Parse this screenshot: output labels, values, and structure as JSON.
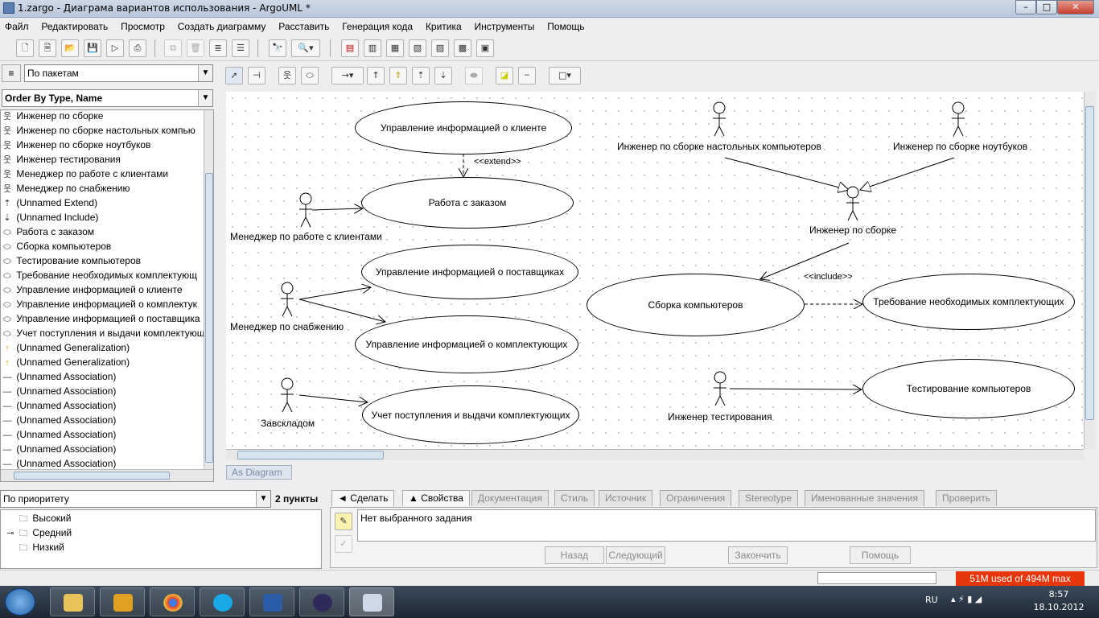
{
  "window": {
    "title": "1.zargo - Диаграма вариантов использования - ArgoUML *",
    "controls": [
      "–",
      "□",
      "✕"
    ]
  },
  "menu": [
    "Файл",
    "Редактировать",
    "Просмотр",
    "Создать диаграмму",
    "Расставить",
    "Генерация кода",
    "Критика",
    "Инструменты",
    "Помощь"
  ],
  "explorer": {
    "perspective": "По пакетам",
    "order": "Order By Type, Name",
    "items": [
      {
        "icon": "actor",
        "label": "Инженер по сборке"
      },
      {
        "icon": "actor",
        "label": "Инженер по сборке настольных компью"
      },
      {
        "icon": "actor",
        "label": "Инженер по сборке ноутбуков"
      },
      {
        "icon": "actor",
        "label": "Инженер тестирования"
      },
      {
        "icon": "actor",
        "label": "Менеджер по работе с клиентами"
      },
      {
        "icon": "actor",
        "label": "Менеджер по снабжению"
      },
      {
        "icon": "extend",
        "label": "(Unnamed Extend)"
      },
      {
        "icon": "include",
        "label": "(Unnamed Include)"
      },
      {
        "icon": "usecase",
        "label": "Работа с заказом"
      },
      {
        "icon": "usecase",
        "label": "Сборка компьютеров"
      },
      {
        "icon": "usecase",
        "label": "Тестирование компьютеров"
      },
      {
        "icon": "usecase",
        "label": "Требование необходимых комплектующ"
      },
      {
        "icon": "usecase",
        "label": "Управление информацией о клиенте"
      },
      {
        "icon": "usecase",
        "label": "Управление информацией о комплектук"
      },
      {
        "icon": "usecase",
        "label": "Управление информацией о поставщика"
      },
      {
        "icon": "usecase",
        "label": "Учет поступления и выдачи комплектующ"
      },
      {
        "icon": "generalization",
        "label": "(Unnamed Generalization)"
      },
      {
        "icon": "generalization",
        "label": "(Unnamed Generalization)"
      },
      {
        "icon": "association",
        "label": "(Unnamed Association)"
      },
      {
        "icon": "association",
        "label": "(Unnamed Association)"
      },
      {
        "icon": "association",
        "label": "(Unnamed Association)"
      },
      {
        "icon": "association",
        "label": "(Unnamed Association)"
      },
      {
        "icon": "association",
        "label": "(Unnamed Association)"
      },
      {
        "icon": "association",
        "label": "(Unnamed Association)"
      },
      {
        "icon": "association",
        "label": "(Unnamed Association)"
      }
    ]
  },
  "todo": {
    "by": "По приоритету",
    "count": "2 пункты",
    "items": [
      "Высокий",
      "Средний",
      "Низкий"
    ]
  },
  "diagram": {
    "tab": "As Diagram",
    "usecases": {
      "client_info": "Управление информацией о клиенте",
      "order": "Работа с заказом",
      "suppliers": "Управление информацией о поставщиках",
      "components_info": "Управление информацией о комплектующих",
      "accounting": "Учет поступления и выдачи комплектующих",
      "assembly": "Сборка компьютеров",
      "requirement": "Требование необходимых комплектующих",
      "testing": "Тестирование компьютеров"
    },
    "actors": {
      "client_manager": "Менеджер по работе с клиентами",
      "supply_manager": "Менеджер по снабжению",
      "warehouse": "Завскладом",
      "desktop_engineer": "Инженер по сборке настольных компьютеров",
      "laptop_engineer": "Инженер по сборке ноутбуков",
      "assembly_engineer": "Инженер по сборке",
      "test_engineer": "Инженер тестирования"
    },
    "stereotypes": {
      "extend": "<<extend>>",
      "include": "<<include>>"
    }
  },
  "details": {
    "tabs": [
      {
        "label": "◄ Сделать",
        "active": true
      },
      {
        "label": "▲ Свойства",
        "active": true
      },
      {
        "label": "Документация",
        "active": false
      },
      {
        "label": "Стиль",
        "active": false
      },
      {
        "label": "Источник",
        "active": false
      },
      {
        "label": "Ограничения",
        "active": false
      },
      {
        "label": "Stereotype",
        "active": false
      },
      {
        "label": "Именованные значения",
        "active": false
      },
      {
        "label": "Проверить",
        "active": false
      }
    ],
    "message": "Нет выбранного задания",
    "buttons": {
      "back": "Назад",
      "next": "Следующий",
      "finish": "Закончить",
      "help": "Помощь"
    }
  },
  "status": {
    "memory": "51M used of 494M max",
    "memory_color": "#e8360c"
  },
  "taskbar": {
    "lang": "RU",
    "time": "8:57",
    "date": "18.10.2012"
  }
}
